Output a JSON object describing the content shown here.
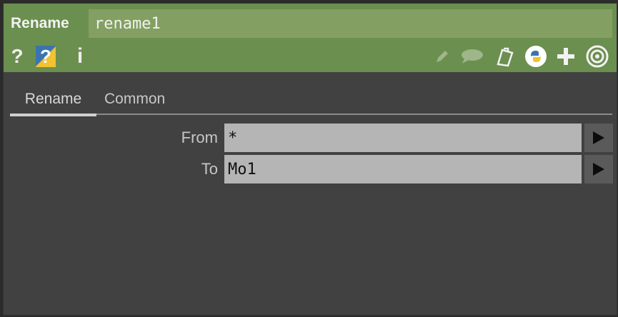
{
  "header": {
    "op_type": "Rename",
    "op_name": "rename1"
  },
  "toolbar": {
    "help_icon": "?",
    "python_help_icon": "?",
    "info_icon": "i",
    "right_icons": [
      "edit-icon",
      "comment-icon",
      "clone-icon",
      "python-icon",
      "add-icon",
      "viewer-icon"
    ]
  },
  "tabs": [
    {
      "label": "Rename",
      "active": true
    },
    {
      "label": "Common",
      "active": false
    }
  ],
  "params": [
    {
      "label": "From",
      "value": "*"
    },
    {
      "label": "To",
      "value": "Mo1"
    }
  ],
  "colors": {
    "header_bg": "#6b8f4e",
    "name_field_bg": "#83a062",
    "panel_bg": "#414141",
    "field_bg": "#b5b5b5"
  }
}
